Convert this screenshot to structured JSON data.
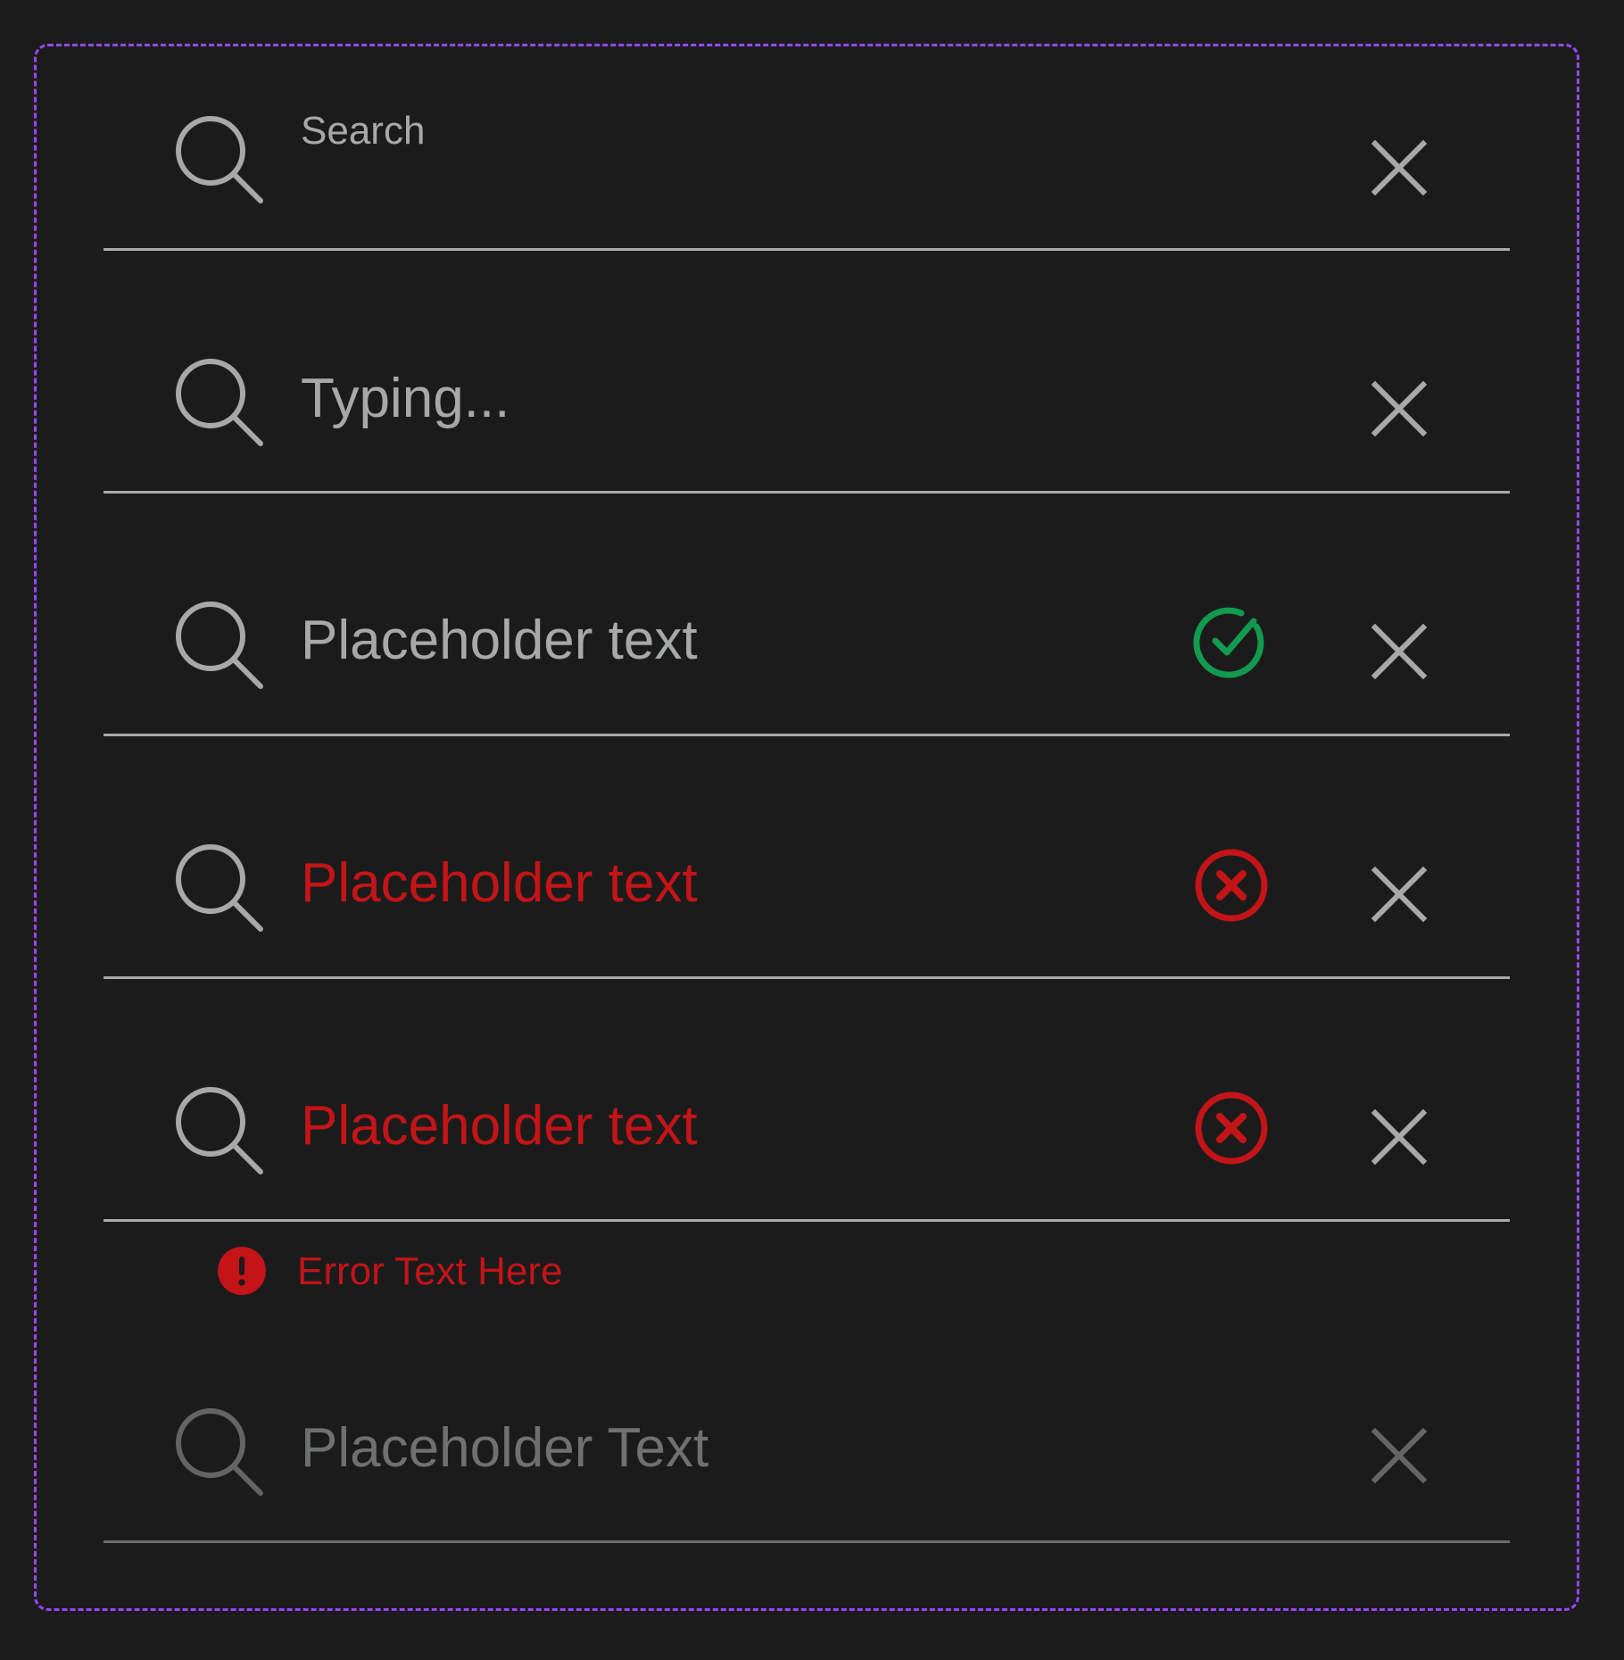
{
  "colors": {
    "background": "#1b1b1c",
    "frame": "#9747ff",
    "text": "#a7a8a8",
    "underline": "#a9aaa9",
    "success": "#129a4f",
    "error": "#c31418",
    "disabled": "#6f7070"
  },
  "fields": [
    {
      "state": "focused",
      "label": "Search",
      "value": "",
      "icons": [
        "search-icon",
        "close-icon"
      ]
    },
    {
      "state": "typing",
      "value": "Typing...",
      "icons": [
        "search-icon",
        "close-icon"
      ]
    },
    {
      "state": "success",
      "value": "Placeholder text",
      "icons": [
        "search-icon",
        "check-circle-icon",
        "close-icon"
      ]
    },
    {
      "state": "error",
      "value": "Placeholder text",
      "icons": [
        "search-icon",
        "error-circle-icon",
        "close-icon"
      ]
    },
    {
      "state": "error-with-message",
      "value": "Placeholder text",
      "helper_text": "Error Text Here",
      "icons": [
        "search-icon",
        "error-circle-icon",
        "close-icon",
        "alert-circle-icon"
      ]
    },
    {
      "state": "disabled",
      "placeholder": "Placeholder Text",
      "icons": [
        "search-icon",
        "close-icon"
      ]
    }
  ]
}
